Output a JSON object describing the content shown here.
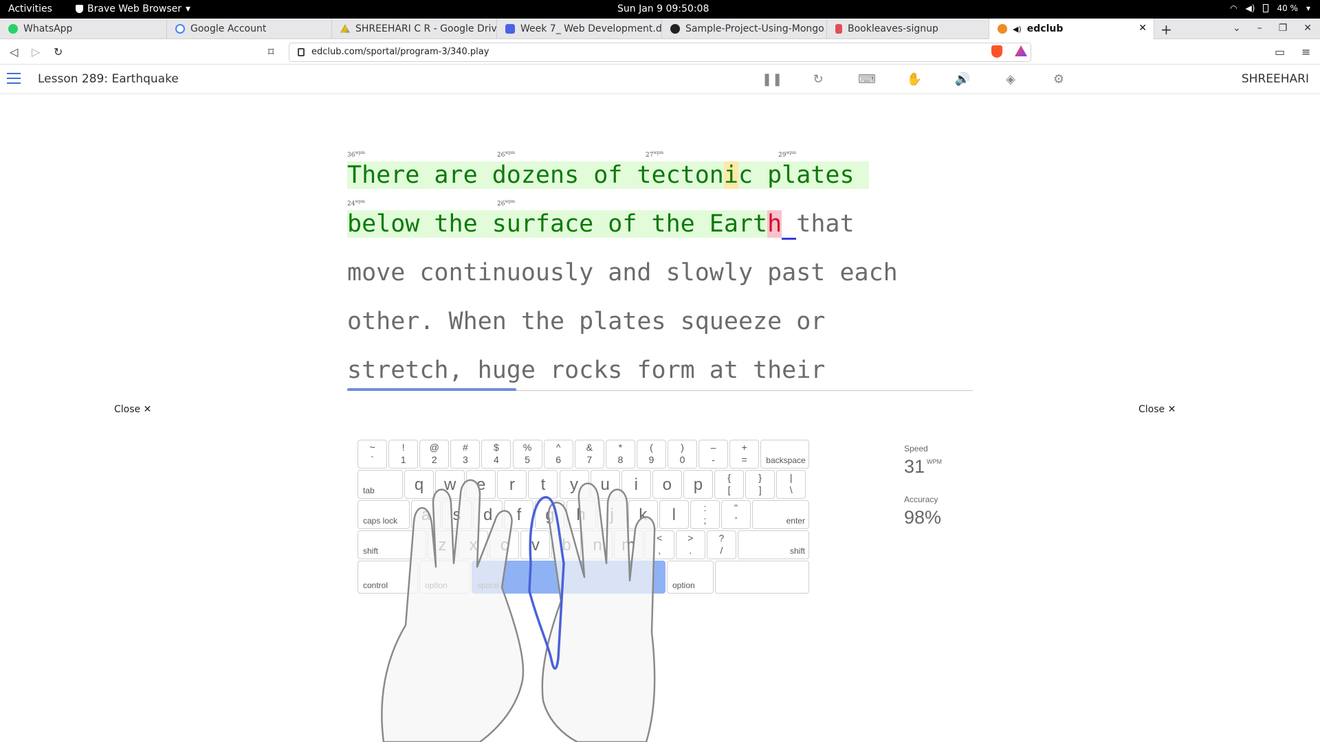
{
  "system": {
    "activities": "Activities",
    "app_menu": "Brave Web Browser",
    "clock": "Sun Jan 9  09:50:08",
    "battery": "40 %"
  },
  "tabs": [
    {
      "label": "WhatsApp",
      "color": "#25d366"
    },
    {
      "label": "Google Account",
      "color": "#4285f4"
    },
    {
      "label": "SHREEHARI C R - Google Drive",
      "color": "#fbbc04"
    },
    {
      "label": "Week 7_ Web Development.d",
      "color": "#4a63e6"
    },
    {
      "label": "Sample-Project-Using-Mongo",
      "color": "#222222"
    },
    {
      "label": "Bookleaves-signup",
      "color": "#e04e5a"
    },
    {
      "label": "edclub",
      "color": "#f08a24"
    }
  ],
  "address_bar": {
    "url": "edclub.com/sportal/program-3/340.play"
  },
  "app": {
    "lesson_title": "Lesson 289: Earthquake",
    "username": "SHREEHARI",
    "tools": [
      "pause-icon",
      "restart-icon",
      "keyboard-icon",
      "hand-icon",
      "sound-icon",
      "theme-icon",
      "settings-icon"
    ]
  },
  "typing": {
    "wpm_unit": "wpm",
    "line1": {
      "part1": "There are dozens of tecton",
      "warn": "i",
      "part2": "c plates ",
      "wpm": [
        "36",
        "26",
        "27",
        "29"
      ]
    },
    "line2": {
      "typed": "below the surface of the Eart",
      "error": "h",
      "cursor": " ",
      "pending": "that",
      "wpm": [
        "24",
        "26"
      ]
    },
    "line3": "move continuously and slowly past each",
    "line4": "other. When the plates squeeze or",
    "line5": "stretch, huge rocks form at their",
    "progress_fraction": 0.27
  },
  "close_label": "Close ✕",
  "keyboard": {
    "row1": [
      {
        "t": "~",
        "b": "`"
      },
      {
        "t": "!",
        "b": "1"
      },
      {
        "t": "@",
        "b": "2"
      },
      {
        "t": "#",
        "b": "3"
      },
      {
        "t": "$",
        "b": "4"
      },
      {
        "t": "%",
        "b": "5"
      },
      {
        "t": "^",
        "b": "6"
      },
      {
        "t": "&",
        "b": "7"
      },
      {
        "t": "*",
        "b": "8"
      },
      {
        "t": "(",
        "b": "9"
      },
      {
        "t": ")",
        "b": "0"
      },
      {
        "t": "–",
        "b": "-"
      },
      {
        "t": "+",
        "b": "="
      }
    ],
    "backspace": "backspace",
    "tab": "tab",
    "row2": [
      "q",
      "w",
      "e",
      "r",
      "t",
      "y",
      "u",
      "i",
      "o",
      "p"
    ],
    "row2_sym": [
      {
        "t": "{",
        "b": "["
      },
      {
        "t": "}",
        "b": "]"
      },
      {
        "t": "|",
        "b": "\\"
      }
    ],
    "caps": "caps lock",
    "row3": [
      "a",
      "s",
      "d",
      "f",
      "g",
      "h",
      "j",
      "k",
      "l"
    ],
    "row3_sym": [
      {
        "t": ":",
        "b": ";"
      },
      {
        "t": "\"",
        "b": "'"
      }
    ],
    "enter": "enter",
    "shift": "shift",
    "row4": [
      "z",
      "x",
      "c",
      "v",
      "b",
      "n",
      "m"
    ],
    "row4_sym": [
      {
        "t": "<",
        "b": ","
      },
      {
        "t": ">",
        "b": "."
      },
      {
        "t": "?",
        "b": "/"
      }
    ],
    "control": "control",
    "option": "option",
    "space": "space"
  },
  "stats": {
    "speed_label": "Speed",
    "speed_value": "31",
    "speed_unit": "WPM",
    "accuracy_label": "Accuracy",
    "accuracy_value": "98%"
  },
  "colors": {
    "typed_text": "#0a7a0a",
    "typed_bg": "#e2fbd9",
    "error_bg": "#f9c2cc",
    "warn_bg": "#fde9a8",
    "accent": "#3d6fe0",
    "space_key": "#8fb2f5"
  }
}
